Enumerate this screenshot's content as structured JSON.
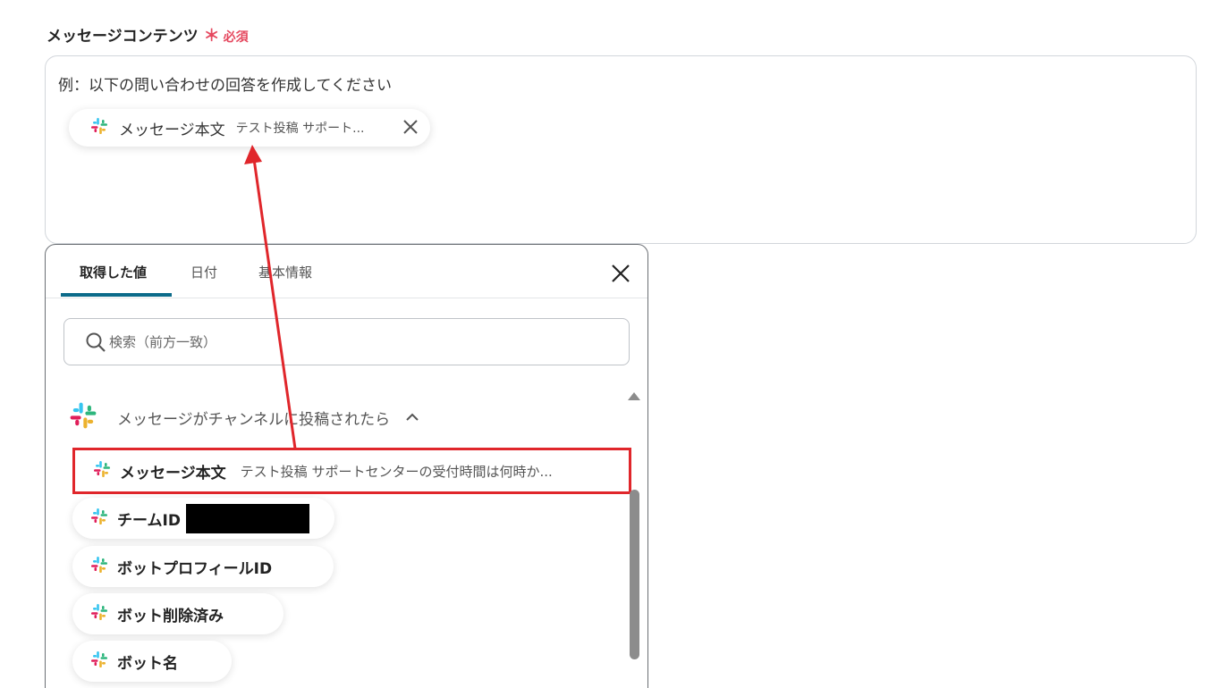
{
  "field": {
    "label": "メッセージコンテンツ",
    "required_star": "＊",
    "required_text": "必須"
  },
  "content": {
    "text": "例：以下の問い合わせの回答を作成してください",
    "chip": {
      "icon": "slack-icon",
      "name": "メッセージ本文",
      "value": "テスト投稿 サポート..."
    }
  },
  "dropdown": {
    "tabs": [
      {
        "label": "取得した値",
        "active": true
      },
      {
        "label": "日付",
        "active": false
      },
      {
        "label": "基本情報",
        "active": false
      }
    ],
    "search_placeholder": "検索（前方一致）",
    "group": {
      "title": "メッセージがチャンネルに投稿されたら",
      "icon": "slack-icon",
      "items": [
        {
          "name": "メッセージ本文",
          "value": "テスト投稿 サポートセンターの受付時間は何時か...",
          "highlighted": true
        },
        {
          "name": "チームID",
          "value": "",
          "redacted": true
        },
        {
          "name": "ボットプロフィールID",
          "value": ""
        },
        {
          "name": "ボット削除済み",
          "value": ""
        },
        {
          "name": "ボット名",
          "value": ""
        }
      ]
    }
  },
  "colors": {
    "accent": "#0c6b8a",
    "required": "#e5485f",
    "highlight": "#e0262b"
  }
}
